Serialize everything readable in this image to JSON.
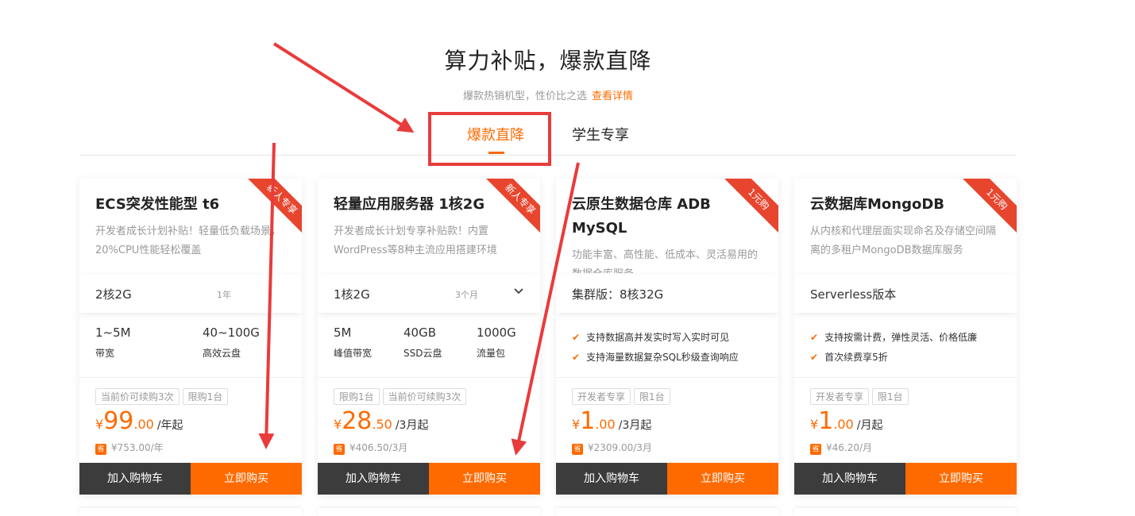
{
  "header": {
    "title": "算力补贴，爆款直降",
    "subtitle": "爆款热销机型，性价比之选",
    "more_link": "查看详情"
  },
  "tabs": [
    {
      "label": "爆款直降",
      "active": true
    },
    {
      "label": "学生专享",
      "active": false
    }
  ],
  "colors": {
    "accent": "#ff6a00",
    "annotation": "#e93b3b",
    "cart_button": "#3c3c3c"
  },
  "cards": [
    {
      "ribbon": "新人专享",
      "name": "ECS突发性能型 t6",
      "desc": "开发者成长计划补贴！轻量低负载场景，20%CPU性能轻松覆盖",
      "spec": "2核2G",
      "duration": "1年",
      "features": [
        {
          "value": "1~5M",
          "label": "带宽"
        },
        {
          "value": "40~100G",
          "label": "高效云盘"
        }
      ],
      "tags": [
        "当前价可续购3次",
        "限购1台"
      ],
      "price": {
        "currency": "¥",
        "int": "99",
        "dec": ".00",
        "unit": "/年起"
      },
      "original": {
        "badge": "省",
        "text": "¥753.00/年"
      },
      "cart_label": "加入购物车",
      "buy_label": "立即购买"
    },
    {
      "ribbon": "新人专享",
      "name": "轻量应用服务器 1核2G",
      "desc": "开发者成长计划专享补贴款！内置WordPress等8种主流应用搭建环境",
      "spec": "1核2G",
      "duration": "3个月",
      "features": [
        {
          "value": "5M",
          "label": "峰值带宽"
        },
        {
          "value": "40GB",
          "label": "SSD云盘"
        },
        {
          "value": "1000G",
          "label": "流量包"
        }
      ],
      "tags": [
        "限购1台",
        "当前价可续购3次"
      ],
      "price": {
        "currency": "¥",
        "int": "28",
        "dec": ".50",
        "unit": "/3月起"
      },
      "original": {
        "badge": "省",
        "text": "¥406.50/3月"
      },
      "cart_label": "加入购物车",
      "buy_label": "立即购买"
    },
    {
      "ribbon": "1元购",
      "name": "云原生数据仓库 ADB MySQL",
      "desc": "功能丰富、高性能、低成本、灵活易用的数据仓库服务",
      "spec": "集群版：8核32G",
      "checks": [
        "支持数据高并发实时写入实时可见",
        "支持海量数据复杂SQL秒级查询响应"
      ],
      "tags": [
        "开发者专享",
        "限1台"
      ],
      "price": {
        "currency": "¥",
        "int": "1",
        "dec": ".00",
        "unit": "/3月起"
      },
      "original": {
        "badge": "省",
        "text": "¥2309.00/3月"
      },
      "cart_label": "加入购物车",
      "buy_label": "立即购买"
    },
    {
      "ribbon": "1元购",
      "name": "云数据库MongoDB",
      "desc": "从内核和代理层面实现命名及存储空间隔离的多租户MongoDB数据库服务",
      "spec": "Serverless版本",
      "checks": [
        "支持按需计费，弹性灵活、价格低廉",
        "首次续费享5折"
      ],
      "tags": [
        "开发者专享",
        "限1台"
      ],
      "price": {
        "currency": "¥",
        "int": "1",
        "dec": ".00",
        "unit": "/月起"
      },
      "original": {
        "badge": "省",
        "text": "¥46.20/月"
      },
      "cart_label": "加入购物车",
      "buy_label": "立即购买"
    }
  ]
}
